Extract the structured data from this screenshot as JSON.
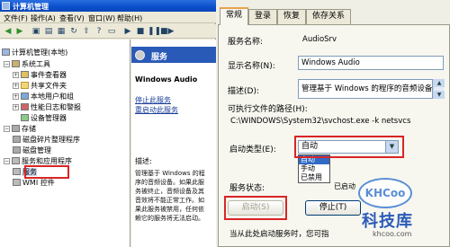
{
  "left_window": {
    "title": "计算机管理",
    "menu": [
      "文件(F)",
      "操作(A)",
      "查看(V)",
      "窗口(W)",
      "帮助(H)"
    ],
    "tree": [
      {
        "label": "计算机管理(本地)",
        "icon": "computer-icon"
      },
      {
        "label": "系统工具",
        "icon": "tools-icon",
        "expander": "-"
      },
      {
        "label": "事件查看器",
        "icon": "event-icon",
        "expander": "+"
      },
      {
        "label": "共享文件夹",
        "icon": "folder-icon",
        "expander": "+"
      },
      {
        "label": "本地用户和组",
        "icon": "users-icon",
        "expander": "+"
      },
      {
        "label": "性能日志和警报",
        "icon": "perf-icon",
        "expander": "+"
      },
      {
        "label": "设备管理器",
        "icon": "device-icon"
      },
      {
        "label": "存储",
        "icon": "storage-icon",
        "expander": "-"
      },
      {
        "label": "磁盘碎片整理程序",
        "icon": "defrag-icon"
      },
      {
        "label": "磁盘管理",
        "icon": "disk-icon"
      },
      {
        "label": "服务和应用程序",
        "icon": "apps-icon",
        "expander": "-"
      },
      {
        "label": "服务",
        "icon": "services-icon"
      },
      {
        "label": "WMI 控件",
        "icon": "wmi-icon"
      }
    ],
    "detail": {
      "header": "服务",
      "service_name": "Windows Audio",
      "links": [
        "停止此服务",
        "重启动此服务"
      ],
      "description_label": "描述:",
      "description_lines": [
        "管理基于 Windows 的程",
        "序的音频设备。如果此服",
        "务被终止，音频设备及其",
        "音效将不能正常工作。如",
        "果此服务被禁用，任何依",
        "赖它的服务将无法启动。"
      ]
    }
  },
  "dialog": {
    "tabs": [
      "常规",
      "登录",
      "恢复",
      "依存关系"
    ],
    "service_name_label": "服务名称:",
    "service_name_value": "AudioSrv",
    "display_name_label": "显示名称(N):",
    "display_name_value": "Windows Audio",
    "description_label": "描述(D):",
    "description_value": "管理基于 Windows 的程序的音频设备。",
    "exe_path_label": "可执行文件的路径(H):",
    "exe_path_value": "C:\\WINDOWS\\System32\\svchost.exe -k netsvcs",
    "startup_type_label": "启动类型(E):",
    "startup_type_value": "自动",
    "startup_options": [
      "自动",
      "手动",
      "已禁用"
    ],
    "service_status_label": "服务状态:",
    "service_status_value": "已启动",
    "buttons": {
      "start": "启动(S)",
      "stop": "停止(T)"
    },
    "footer": "当从此处启动服务时，您可指"
  },
  "watermark": {
    "logo": "KHCoo",
    "site": "科技库",
    "url": "khcoo.com"
  },
  "colors": {
    "highlight_box": "#d92525",
    "title_bar": "#0a4ecb",
    "detail_header": "#2a5ab8"
  }
}
